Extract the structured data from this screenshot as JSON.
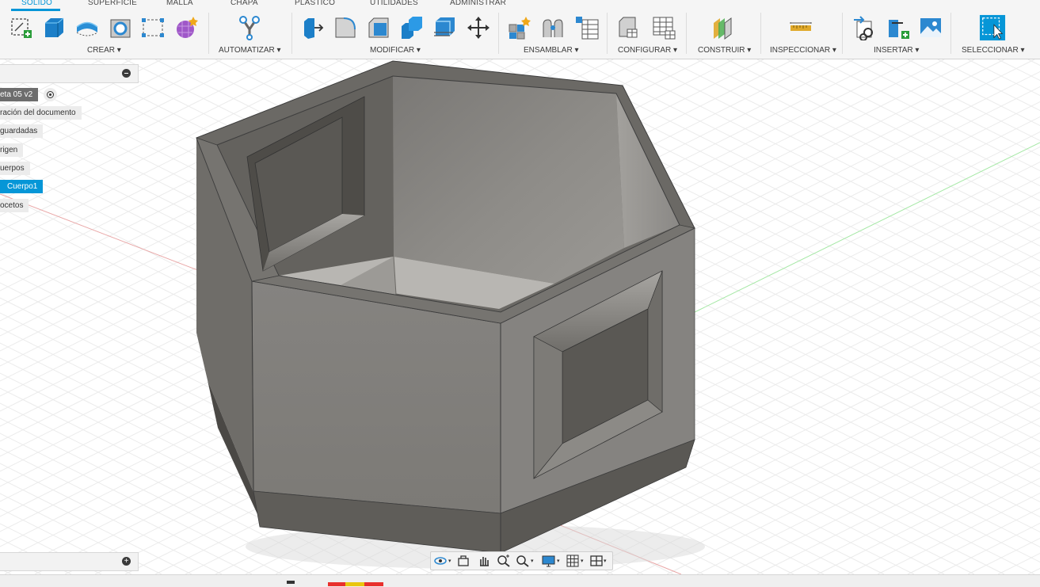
{
  "toolbar": {
    "tabs": [
      {
        "label": "SÓLIDO",
        "active": true
      },
      {
        "label": "SUPERFICIE"
      },
      {
        "label": "MALLA"
      },
      {
        "label": "CHAPA"
      },
      {
        "label": "PLÁSTICO"
      },
      {
        "label": "UTILIDADES"
      },
      {
        "label": "ADMINISTRAR"
      }
    ],
    "groups": [
      {
        "label": "CREAR ▾",
        "icons": [
          "new-sketch-icon",
          "extrude-box-icon",
          "revolve-icon",
          "hole-icon",
          "rectangle-pattern-icon",
          "create-form-icon"
        ]
      },
      {
        "label": "AUTOMATIZAR ▾",
        "icons": [
          "automate-icon"
        ]
      },
      {
        "label": "MODIFICAR ▾",
        "icons": [
          "press-pull-icon",
          "fillet-icon",
          "chamfer-icon",
          "combine-icon",
          "shell-icon",
          "move-icon"
        ]
      },
      {
        "label": "ENSAMBLAR ▾",
        "icons": [
          "new-component-icon",
          "joint-icon",
          "bill-of-materials-icon"
        ]
      },
      {
        "label": "CONFIGURAR ▾",
        "icons": [
          "configure-icon",
          "configuration-table-icon"
        ]
      },
      {
        "label": "CONSTRUIR ▾",
        "icons": [
          "offset-plane-icon"
        ]
      },
      {
        "label": "INSPECCIONAR ▾",
        "icons": [
          "measure-icon"
        ]
      },
      {
        "label": "INSERTAR ▾",
        "icons": [
          "insert-derive-icon",
          "insert-mcmaster-icon",
          "insert-image-icon"
        ]
      },
      {
        "label": "SELECCIONAR ▾",
        "icons": [
          "select-icon"
        ]
      }
    ]
  },
  "browser": {
    "nodes": [
      {
        "label": "eta 05 v2",
        "style": "dark"
      },
      {
        "label": "ración del documento"
      },
      {
        "label": "guardadas"
      },
      {
        "label": "rigen"
      },
      {
        "label": "uerpos"
      },
      {
        "label": "Cuerpo1",
        "selected": true
      },
      {
        "label": "ocetos"
      }
    ]
  },
  "navbar": {
    "tools": [
      "orbit-icon",
      "look-at-icon",
      "pan-icon",
      "zoom-icon",
      "fit-icon",
      "display-settings-icon",
      "grid-settings-icon",
      "viewports-icon"
    ]
  },
  "colors": {
    "accent": "#0696d7",
    "model_gray": "#7e7c78",
    "grid_line": "#e2e2e2",
    "x_axis": "#e8a0a0",
    "y_axis": "#9fe09f"
  }
}
